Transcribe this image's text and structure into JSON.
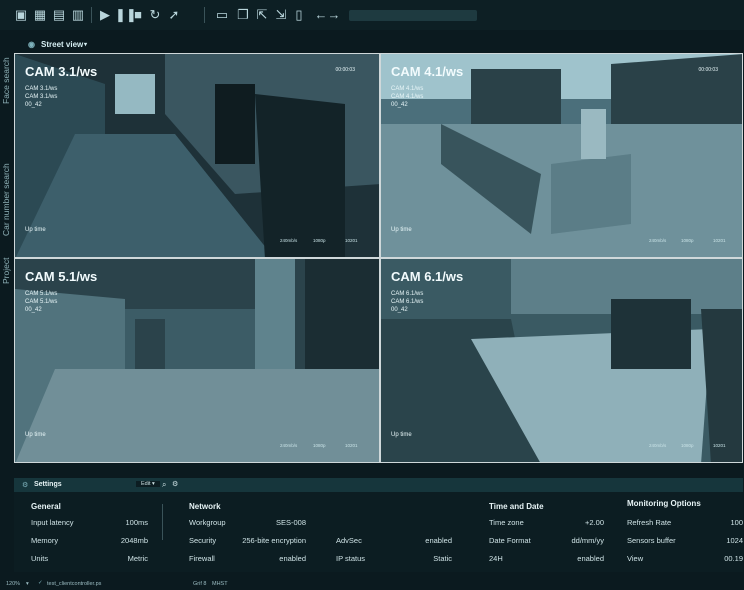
{
  "toolbar": {
    "icons": [
      "record-icon",
      "layout-icon",
      "save-icon",
      "mixer-icon",
      "play-icon",
      "pause-icon",
      "stop-icon",
      "cycle-icon",
      "pointer-icon",
      "window-icon",
      "window-stack-icon",
      "export-icon",
      "export-alt-icon",
      "page-icon",
      "back-arrow-icon",
      "forward-arrow-icon"
    ]
  },
  "sidebar": {
    "tabs": [
      "Face search",
      "Car number search",
      "Project"
    ]
  },
  "view": {
    "label": "Street view",
    "caret": "▾"
  },
  "cameras": [
    {
      "title": "CAM 3.1/ws",
      "line1": "CAM 3.1/ws",
      "line2": "CAM 3.1/ws",
      "line3": "00_42",
      "timestamp": "00:00:03",
      "uptime": "Up time",
      "stat1": "240mb/s",
      "stat2": "1080p",
      "stat3": "10201"
    },
    {
      "title": "CAM 4.1/ws",
      "line1": "CAM 4.1/ws",
      "line2": "CAM 4.1/ws",
      "line3": "00_42",
      "timestamp": "00:00:03",
      "uptime": "Up time",
      "stat1": "240mb/s",
      "stat2": "1080p",
      "stat3": "10201"
    },
    {
      "title": "CAM 5.1/ws",
      "line1": "CAM 5.1/ws",
      "line2": "CAM 5.1/ws",
      "line3": "00_42",
      "timestamp": "",
      "uptime": "Up time",
      "stat1": "240mb/s",
      "stat2": "1080p",
      "stat3": "10201"
    },
    {
      "title": "CAM 6.1/ws",
      "line1": "CAM 6.1/ws",
      "line2": "CAM 6.1/ws",
      "line3": "00_42",
      "timestamp": "",
      "uptime": "Up time",
      "stat1": "240mb/s",
      "stat2": "1080p",
      "stat3": "10201"
    }
  ],
  "settings": {
    "title": "Settings",
    "edit_label": "Edit ▾",
    "general": {
      "heading": "General",
      "rows": [
        {
          "label": "Input latency",
          "value": "100ms"
        },
        {
          "label": "Memory",
          "value": "2048mb"
        },
        {
          "label": "Units",
          "value": "Metric"
        }
      ]
    },
    "network": {
      "heading": "Network",
      "rows": [
        {
          "label": "Workgroup",
          "value": "SES-008"
        },
        {
          "label": "Security",
          "value": "256-bite encryption"
        },
        {
          "label": "Firewall",
          "value": "enabled"
        }
      ],
      "rows2": [
        {
          "label": "AdvSec",
          "value": "enabled"
        },
        {
          "label": "IP status",
          "value": "Static"
        }
      ]
    },
    "time": {
      "heading": "Time and Date",
      "rows": [
        {
          "label": "Time zone",
          "value": "+2.00"
        },
        {
          "label": "Date Format",
          "value": "dd/mm/yy"
        },
        {
          "label": "24H",
          "value": "enabled"
        }
      ]
    },
    "monitoring": {
      "heading": "Monitoring Options",
      "rows": [
        {
          "label": "Refresh Rate",
          "value": "100"
        },
        {
          "label": "Sensors buffer",
          "value": "1024"
        },
        {
          "label": "View",
          "value": "00.19"
        }
      ]
    }
  },
  "status": {
    "zoom": "120%",
    "zoom_caret": "▾",
    "file": "test_clientcontroller.ps",
    "grid": "Grif 8",
    "mode": "MHST"
  }
}
